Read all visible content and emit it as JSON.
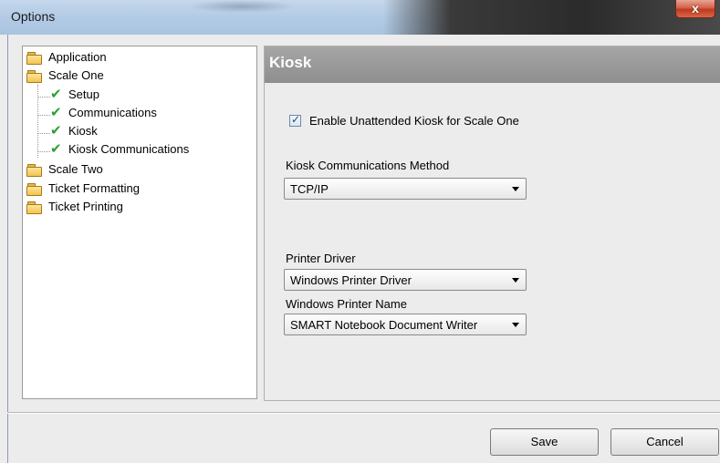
{
  "window": {
    "title": "Options",
    "close_glyph": "x"
  },
  "tree": {
    "items": [
      {
        "label": "Application",
        "icon": "folder-icon"
      },
      {
        "label": "Scale One",
        "icon": "folder-icon"
      },
      {
        "label": "Setup",
        "icon": "checkmark-icon"
      },
      {
        "label": "Communications",
        "icon": "checkmark-icon"
      },
      {
        "label": "Kiosk",
        "icon": "checkmark-icon"
      },
      {
        "label": "Kiosk Communications",
        "icon": "checkmark-icon"
      },
      {
        "label": "Scale Two",
        "icon": "folder-icon"
      },
      {
        "label": "Ticket Formatting",
        "icon": "folder-icon"
      },
      {
        "label": "Ticket Printing",
        "icon": "folder-icon"
      }
    ]
  },
  "panel": {
    "title": "Kiosk",
    "enable_checkbox": {
      "label": "Enable Unattended Kiosk for Scale One",
      "checked": true
    },
    "comm_method": {
      "label": "Kiosk Communications Method",
      "value": "TCP/IP"
    },
    "printer_driver": {
      "label": "Printer Driver",
      "value": "Windows Printer Driver"
    },
    "printer_name": {
      "label": "Windows Printer Name",
      "value": "SMART Notebook Document Writer"
    }
  },
  "buttons": {
    "save": "Save",
    "cancel": "Cancel"
  },
  "colors": {
    "header": "#9a9a9a",
    "check_green": "#2e9d35",
    "close_red": "#c0391e"
  }
}
